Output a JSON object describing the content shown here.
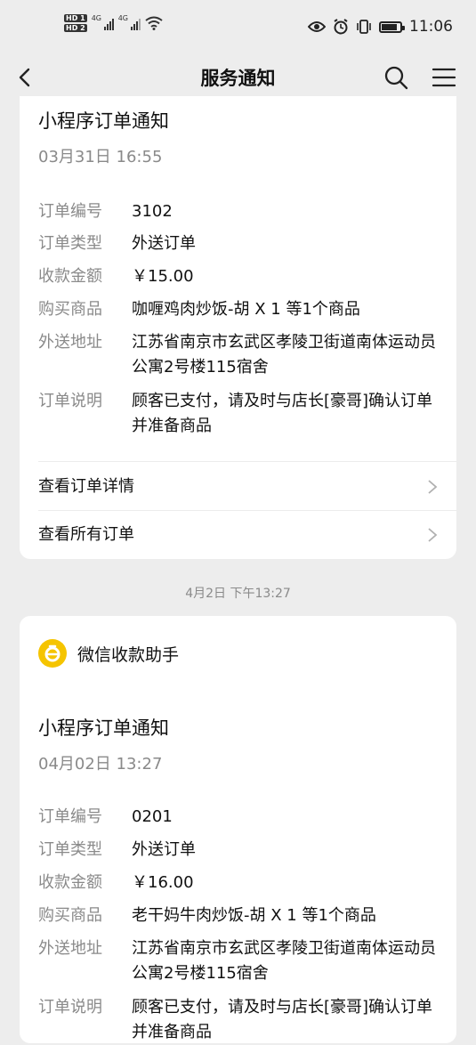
{
  "status": {
    "time": "11:06",
    "hd1": "HD 1",
    "hd2": "HD 2",
    "net1": "4G",
    "net2": "4G",
    "battery_level": 0.85
  },
  "nav": {
    "title": "服务通知"
  },
  "cards": [
    {
      "title": "小程序订单通知",
      "date": "03月31日 16:55",
      "rows": [
        {
          "label": "订单编号",
          "value": "3102"
        },
        {
          "label": "订单类型",
          "value": "外送订单"
        },
        {
          "label": "收款金额",
          "value": "￥15.00"
        },
        {
          "label": "购买商品",
          "value": "咖喱鸡肉炒饭-胡 X 1 等1个商品"
        },
        {
          "label": "外送地址",
          "value": "江苏省南京市玄武区孝陵卫街道南体运动员公寓2号楼115宿舍"
        },
        {
          "label": "订单说明",
          "value": "顾客已支付，请及时与店长[豪哥]确认订单并准备商品"
        }
      ],
      "links": [
        "查看订单详情",
        "查看所有订单"
      ]
    },
    {
      "app_name": "微信收款助手",
      "title": "小程序订单通知",
      "date": "04月02日 13:27",
      "rows": [
        {
          "label": "订单编号",
          "value": "0201"
        },
        {
          "label": "订单类型",
          "value": "外送订单"
        },
        {
          "label": "收款金额",
          "value": "￥16.00"
        },
        {
          "label": "购买商品",
          "value": "老干妈牛肉炒饭-胡 X 1 等1个商品"
        },
        {
          "label": "外送地址",
          "value": "江苏省南京市玄武区孝陵卫街道南体运动员公寓2号楼115宿舍"
        },
        {
          "label": "订单说明",
          "value": "顾客已支付，请及时与店长[豪哥]确认订单并准备商品"
        }
      ]
    }
  ],
  "timestamp": "4月2日 下午13:27",
  "colors": {
    "accent": "#f5c400",
    "background": "#ededed",
    "muted": "#8a8a8a"
  }
}
